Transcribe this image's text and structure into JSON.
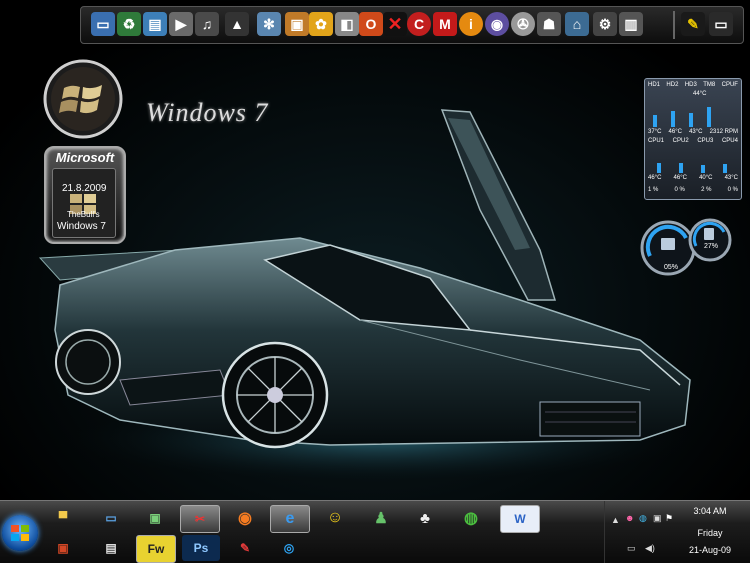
{
  "desktop": {
    "os_logo_text": "Windows 7",
    "badge": {
      "brand": "Microsoft",
      "date": "21.8.2009",
      "author": "TheBull's",
      "edition": "Windows 7"
    }
  },
  "sensor_gadget": {
    "headers": [
      "HD1",
      "HD2",
      "HD3",
      "TM8",
      "CPUF"
    ],
    "cpu_temp_top": "44°C",
    "temps": [
      "37°C",
      "46°C",
      "43°C",
      "2312 RPM"
    ],
    "cpu_labels": [
      "CPU1",
      "CPU2",
      "CPU3",
      "CPU4"
    ],
    "cpu_temps": [
      "46°C",
      "46°C",
      "40°C",
      "43°C"
    ],
    "cpu_usage": [
      "1 %",
      "0 %",
      "2 %",
      "0 %"
    ],
    "accent": "#2ea3f2"
  },
  "gauge_gadget": {
    "left_value": "05%",
    "right_value": "27%"
  },
  "dock": {
    "icons": [
      "computer-icon",
      "recycle-bin-icon",
      "control-panel-icon",
      "media-player-icon",
      "music-icon",
      "rocket-icon",
      "snowflake-icon",
      "package-icon",
      "sunflower-icon",
      "image-viewer-icon",
      "opera-icon",
      "x-icon",
      "ccleaner-icon",
      "mcafee-icon",
      "info-icon",
      "dvd-icon",
      "film-reel-icon",
      "user-icon",
      "network-icon",
      "settings-icon",
      "document-icon",
      "tools-icon",
      "monitor-icon"
    ]
  },
  "taskbar": {
    "pinned_top": [
      "folder-icon",
      "remote-desktop-icon",
      "network-monitor-icon",
      "snipping-tool-icon",
      "firefox-icon",
      "internet-explorer-icon",
      "yahoo-messenger-icon",
      "live-messenger-icon",
      "qq-icon",
      "utorrent-icon",
      "word-icon"
    ],
    "pinned_bottom": [
      "powerpoint-icon",
      "notepad-icon",
      "fireworks-icon",
      "photoshop-icon",
      "paint-icon",
      "media-center-icon"
    ],
    "fireworks_label": "Fw",
    "photoshop_label": "Ps",
    "clock": {
      "time": "3:04 AM",
      "day": "Friday",
      "date": "21-Aug-09"
    }
  }
}
